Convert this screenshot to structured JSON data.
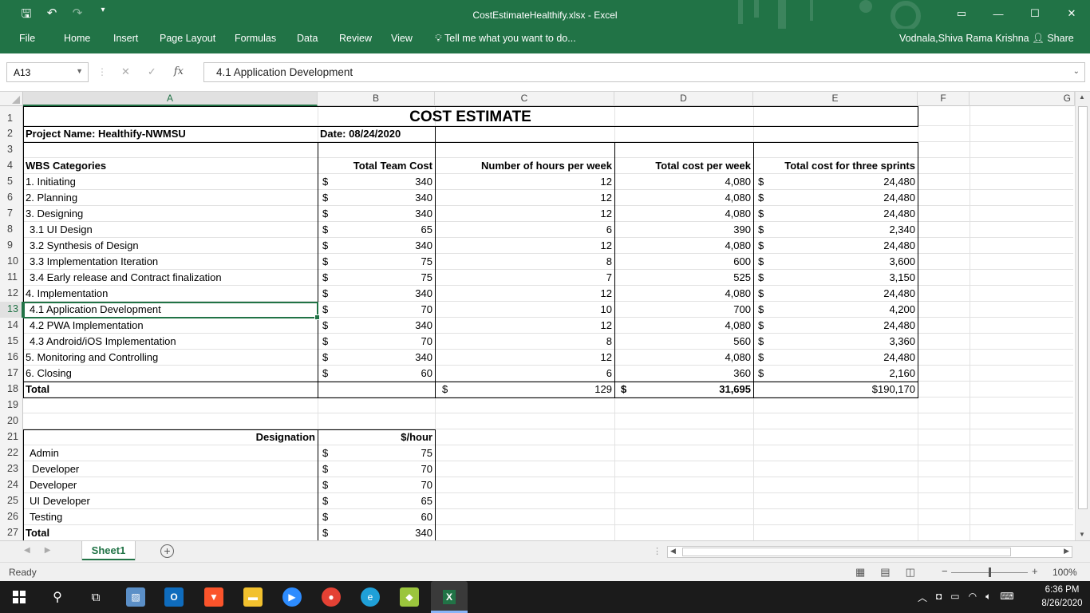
{
  "window": {
    "title": "CostEstimateHealthify.xlsx - Excel",
    "user": "Vodnala,Shiva Rama Krishna",
    "share_label": "Share",
    "accent_color": "#217346"
  },
  "ribbon_tabs": [
    "File",
    "Home",
    "Insert",
    "Page Layout",
    "Formulas",
    "Data",
    "Review",
    "View"
  ],
  "tell_me": "Tell me what you want to do...",
  "formula_bar": {
    "name_box": "A13",
    "content": "4.1 Application Development",
    "fx_label": "fx"
  },
  "columns": [
    "A",
    "B",
    "C",
    "D",
    "E",
    "F",
    "G"
  ],
  "active_cell": "A13",
  "sheet": {
    "title": "COST ESTIMATE",
    "project_name": "Project Name: Healthify-NWMSU",
    "date": "Date: 08/24/2020",
    "headers": [
      "WBS Categories",
      "Total Team Cost",
      "Number of hours per week",
      "Total cost per week",
      "Total cost for three sprints"
    ],
    "rows": [
      {
        "label": "1. Initiating",
        "team_cost": "340",
        "hours": "12",
        "cost_week": "4,080",
        "cost_sprints": "24,480"
      },
      {
        "label": "2. Planning",
        "team_cost": "340",
        "hours": "12",
        "cost_week": "4,080",
        "cost_sprints": "24,480"
      },
      {
        "label": "3. Designing",
        "team_cost": "340",
        "hours": "12",
        "cost_week": "4,080",
        "cost_sprints": "24,480"
      },
      {
        "label": "3.1 UI Design",
        "team_cost": "65",
        "hours": "6",
        "cost_week": "390",
        "cost_sprints": "2,340"
      },
      {
        "label": "3.2 Synthesis of Design",
        "team_cost": "340",
        "hours": "12",
        "cost_week": "4,080",
        "cost_sprints": "24,480"
      },
      {
        "label": "3.3 Implementation Iteration",
        "team_cost": "75",
        "hours": "8",
        "cost_week": "600",
        "cost_sprints": "3,600"
      },
      {
        "label": "3.4 Early release and Contract finalization",
        "team_cost": "75",
        "hours": "7",
        "cost_week": "525",
        "cost_sprints": "3,150"
      },
      {
        "label": "4. Implementation",
        "team_cost": "340",
        "hours": "12",
        "cost_week": "4,080",
        "cost_sprints": "24,480"
      },
      {
        "label": "4.1 Application Development",
        "team_cost": "70",
        "hours": "10",
        "cost_week": "700",
        "cost_sprints": "4,200"
      },
      {
        "label": "4.2 PWA Implementation",
        "team_cost": "340",
        "hours": "12",
        "cost_week": "4,080",
        "cost_sprints": "24,480"
      },
      {
        "label": "4.3 Android/iOS Implementation",
        "team_cost": "70",
        "hours": "8",
        "cost_week": "560",
        "cost_sprints": "3,360"
      },
      {
        "label": "5. Monitoring and Controlling",
        "team_cost": "340",
        "hours": "12",
        "cost_week": "4,080",
        "cost_sprints": "24,480"
      },
      {
        "label": "6. Closing",
        "team_cost": "60",
        "hours": "6",
        "cost_week": "360",
        "cost_sprints": "2,160"
      }
    ],
    "total": {
      "label": "Total",
      "hours": "129",
      "cost_week": "31,695",
      "cost_sprints": "$190,170"
    },
    "currency": "$",
    "rates_header": {
      "designation": "Designation",
      "rate": "$/hour"
    },
    "rates": [
      {
        "designation": "Admin",
        "rate": "75"
      },
      {
        "designation": "Developer",
        "rate": "70"
      },
      {
        "designation": "Developer",
        "rate": "70"
      },
      {
        "designation": "UI Developer",
        "rate": "65"
      },
      {
        "designation": "Testing",
        "rate": "60"
      },
      {
        "designation": "Total",
        "rate": "340"
      }
    ]
  },
  "sheet_tabs": [
    "Sheet1"
  ],
  "status": {
    "ready": "Ready",
    "zoom": "100%"
  },
  "taskbar": {
    "time": "6:36 PM",
    "date": "8/26/2020"
  }
}
